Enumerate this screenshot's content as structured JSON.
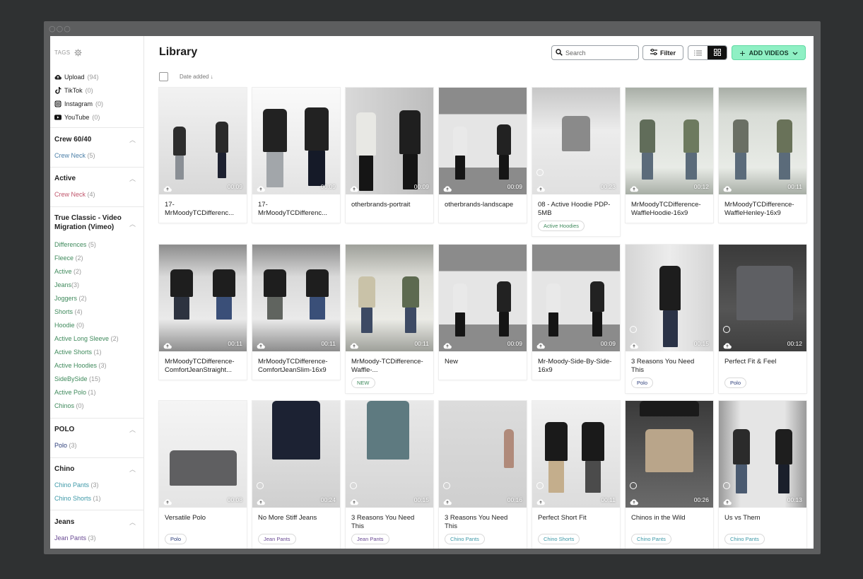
{
  "window": {
    "dots": "○○○"
  },
  "sidebar": {
    "tags_label": "TAGS",
    "sources": [
      {
        "label": "Upload",
        "count": "(94)",
        "icon": "cloud-upload-icon"
      },
      {
        "label": "TikTok",
        "count": "(0)",
        "icon": "tiktok-icon"
      },
      {
        "label": "Instagram",
        "count": "(0)",
        "icon": "instagram-icon"
      },
      {
        "label": "YouTube",
        "count": "(0)",
        "icon": "youtube-icon"
      }
    ],
    "groups": [
      {
        "title": "Crew 60/40",
        "tags": [
          {
            "label": "Crew Neck",
            "count": "(5)"
          }
        ]
      },
      {
        "title": "Active",
        "tags": [
          {
            "label": "Crew Neck",
            "count": "(4)"
          }
        ]
      },
      {
        "title": "True Classic - Video Migration (Vimeo)",
        "tags": [
          {
            "label": "Differences",
            "count": "(5)"
          },
          {
            "label": "Fleece",
            "count": "(2)"
          },
          {
            "label": "Active",
            "count": "(2)"
          },
          {
            "label": "Jeans",
            "count": "(3)"
          },
          {
            "label": "Joggers",
            "count": "(2)"
          },
          {
            "label": "Shorts",
            "count": "(4)"
          },
          {
            "label": "Hoodie",
            "count": "(0)"
          },
          {
            "label": "Active Long Sleeve",
            "count": "(2)"
          },
          {
            "label": "Active Shorts",
            "count": "(1)"
          },
          {
            "label": "Active Hoodies",
            "count": "(3)"
          },
          {
            "label": "SideBySide",
            "count": "(15)"
          },
          {
            "label": "Active Polo",
            "count": "(1)"
          },
          {
            "label": "Chinos",
            "count": "(0)"
          }
        ]
      },
      {
        "title": "POLO",
        "tags": [
          {
            "label": "Polo",
            "count": "(3)"
          }
        ]
      },
      {
        "title": "Chino",
        "tags": [
          {
            "label": "Chino Pants",
            "count": "(3)"
          },
          {
            "label": "Chino Shorts",
            "count": "(1)"
          }
        ]
      },
      {
        "title": "Jeans",
        "tags": [
          {
            "label": "Jean Pants",
            "count": "(3)"
          }
        ]
      }
    ]
  },
  "header": {
    "title": "Library",
    "search_placeholder": "Search",
    "filter_label": "Filter",
    "add_label": "ADD VIDEOS",
    "sort_label": "Date added"
  },
  "colors": {
    "accent": "#8ff0c4",
    "sidebar_tag_blue": "#4b7fa8"
  },
  "videos": [
    {
      "title": "17-MrMoodyTCDifferenc...",
      "duration": "00:09",
      "tag": ""
    },
    {
      "title": "17-MrMoodyTCDifferenc...",
      "duration": "00:09",
      "tag": ""
    },
    {
      "title": "otherbrands-portrait",
      "duration": "00:09",
      "tag": ""
    },
    {
      "title": "otherbrands-landscape",
      "duration": "00:09",
      "tag": ""
    },
    {
      "title": "08 - Active Hoodie PDP-5MB",
      "duration": "00:23",
      "tag": "Active Hoodies"
    },
    {
      "title": "MrMoodyTCDifference-WaffleHoodie-16x9",
      "duration": "00:12",
      "tag": ""
    },
    {
      "title": "MrMoodyTCDifference-WaffleHenley-16x9",
      "duration": "00:11",
      "tag": ""
    },
    {
      "title": "MrMoodyTCDifference-ComfortJeanStraight...",
      "duration": "00:11",
      "tag": ""
    },
    {
      "title": "MrMoodyTCDifference-ComfortJeanSlim-16x9",
      "duration": "00:11",
      "tag": ""
    },
    {
      "title": "MrMoody-TCDifference-Waffle-...",
      "duration": "00:11",
      "tag": "NEW"
    },
    {
      "title": "New",
      "duration": "00:09",
      "tag": ""
    },
    {
      "title": "Mr-Moody-Side-By-Side-16x9",
      "duration": "00:09",
      "tag": ""
    },
    {
      "title": "3 Reasons You Need This",
      "duration": "00:15",
      "tag": "Polo"
    },
    {
      "title": "Perfect Fit & Feel",
      "duration": "00:12",
      "tag": "Polo"
    },
    {
      "title": "Versatile Polo",
      "duration": "00:08",
      "tag": "Polo"
    },
    {
      "title": "No More Stiff Jeans",
      "duration": "00:24",
      "tag": "Jean Pants"
    },
    {
      "title": "3 Reasons You Need This",
      "duration": "00:15",
      "tag": "Jean Pants"
    },
    {
      "title": "3 Reasons You Need This",
      "duration": "00:16",
      "tag": "Chino Pants"
    },
    {
      "title": "Perfect Short Fit",
      "duration": "00:11",
      "tag": "Chino Shorts"
    },
    {
      "title": "Chinos in the Wild",
      "duration": "00:26",
      "tag": "Chino Pants"
    },
    {
      "title": "Us vs Them",
      "duration": "00:13",
      "tag": "Chino Pants"
    }
  ]
}
